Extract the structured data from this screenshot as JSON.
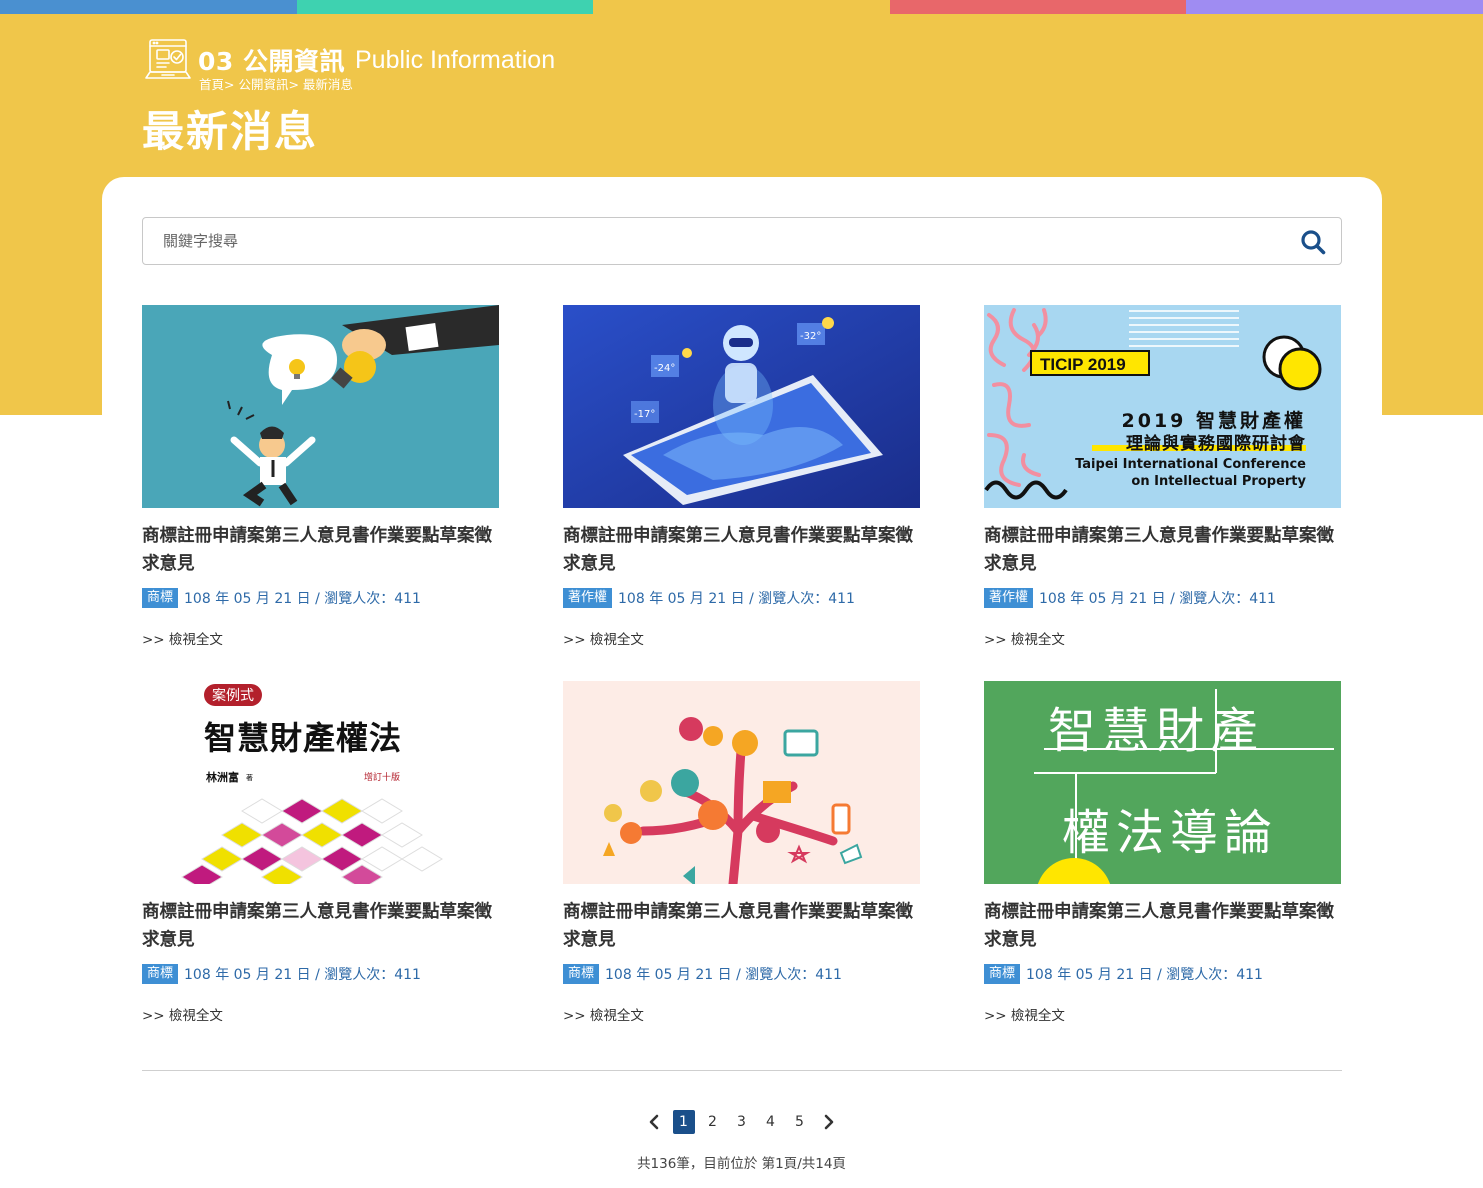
{
  "colors": {
    "bar": [
      "#4a90d0",
      "#3ed2b0",
      "#f0c64a",
      "#e8676a",
      "#9f8cf2"
    ],
    "hero": "#f0c64a",
    "tag": "#3e8fd4",
    "link": "#2e6aa8",
    "active_page": "#1a4f8a"
  },
  "header": {
    "section_number": "03 公開資訊",
    "section_en": "Public Information",
    "breadcrumb": [
      "首頁",
      "> 公開資訊",
      "> 最新消息"
    ],
    "title": "最新消息"
  },
  "search": {
    "placeholder": "關鍵字搜尋",
    "icon": "search-icon"
  },
  "cards": [
    {
      "title": "商標註冊申請案第三人意見書作業要點草案徵求意見",
      "tag": "商標",
      "meta": "108 年 05 月 21 日 / 瀏覽人次：411",
      "more": ">> 檢視全文",
      "image": "idea-cartoon"
    },
    {
      "title": "商標註冊申請案第三人意見書作業要點草案徵求意見",
      "tag": "著作權",
      "meta": "108 年 05 月 21 日 / 瀏覽人次：411",
      "more": ">> 檢視全文",
      "image": "robot-phone"
    },
    {
      "title": "商標註冊申請案第三人意見書作業要點草案徵求意見",
      "tag": "著作權",
      "meta": "108 年 05 月 21 日 / 瀏覽人次：411",
      "more": ">> 檢視全文",
      "image": "ticip-banner"
    },
    {
      "title": "商標註冊申請案第三人意見書作業要點草案徵求意見",
      "tag": "商標",
      "meta": "108 年 05 月 21 日 / 瀏覽人次：411",
      "more": ">> 檢視全文",
      "image": "book-cover"
    },
    {
      "title": "商標註冊申請案第三人意見書作業要點草案徵求意見",
      "tag": "商標",
      "meta": "108 年 05 月 21 日 / 瀏覽人次：411",
      "more": ">> 檢視全文",
      "image": "idea-tree"
    },
    {
      "title": "商標註冊申請案第三人意見書作業要點草案徵求意見",
      "tag": "商標",
      "meta": "108 年 05 月 21 日 / 瀏覽人次：411",
      "more": ">> 檢視全文",
      "image": "green-title"
    }
  ],
  "images": {
    "ticip": {
      "badge": "TICIP 2019",
      "line1": "2019 智慧財產權",
      "line2": "理論與實務國際研討會",
      "line3": "Taipei International Conference",
      "line4": "on Intellectual Property"
    },
    "book": {
      "badge": "案例式",
      "title": "智慧財產權法",
      "author": "林洲富",
      "author_suffix": "著",
      "edition": "增訂十版"
    },
    "green": {
      "line1": "智慧財產",
      "line2": "權法導論"
    },
    "robot": {
      "temp1": "-24°",
      "temp2": "-32°",
      "temp3": "-17°"
    }
  },
  "pagination": {
    "pages": [
      "1",
      "2",
      "3",
      "4",
      "5"
    ],
    "active": "1",
    "prev_icon": "chevron-left-icon",
    "next_icon": "chevron-right-icon",
    "summary": "共136筆，目前位於 第1頁/共14頁"
  }
}
